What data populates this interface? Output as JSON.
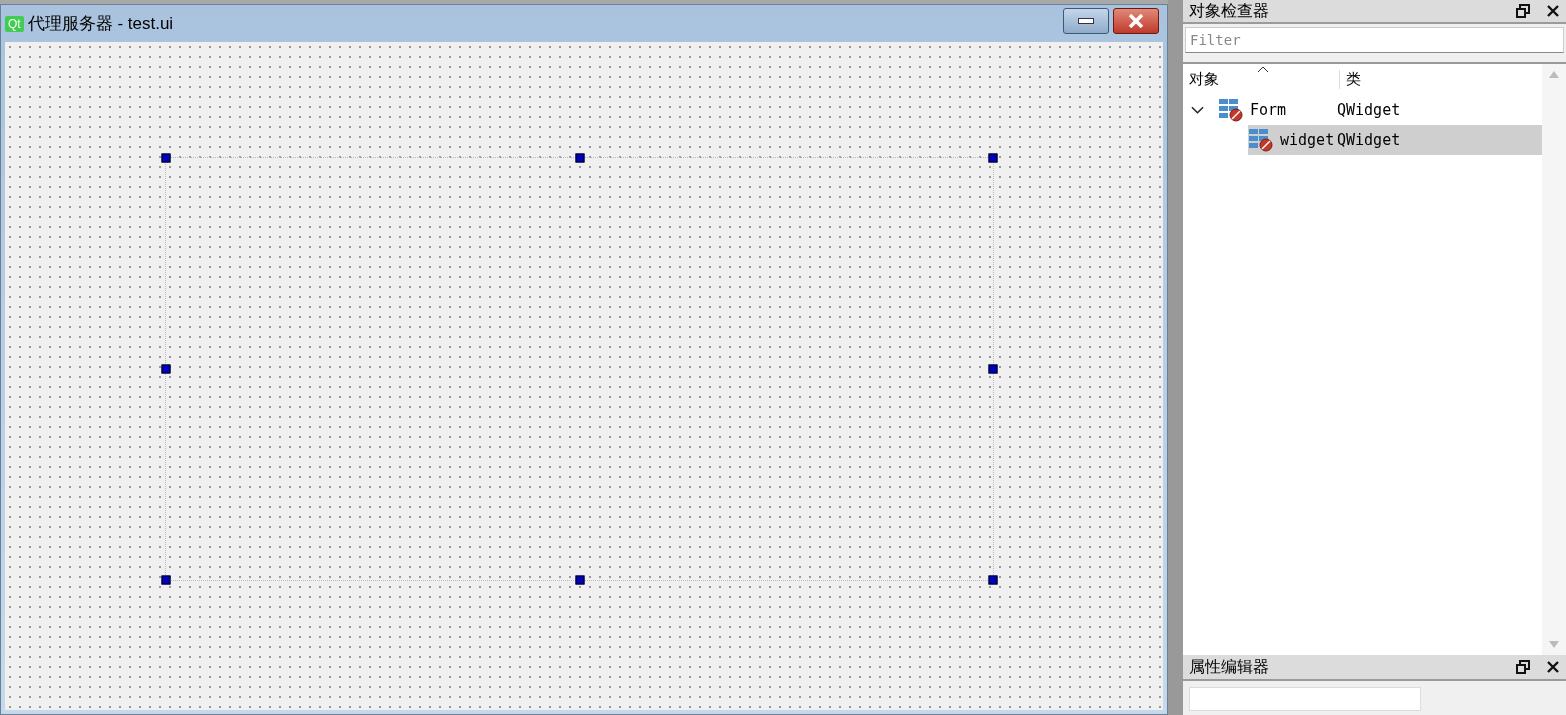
{
  "form_window": {
    "title": "代理服务器 - test.ui",
    "logo": "Qt",
    "selected_widget_visible": true
  },
  "object_inspector": {
    "title": "对象检查器",
    "filter": {
      "placeholder": "Filter"
    },
    "columns": [
      "对象",
      "类"
    ],
    "tree": [
      {
        "name": "Form",
        "class": "QWidget",
        "expanded": true,
        "selected": false,
        "children": [
          {
            "name": "widget",
            "class": "QWidget",
            "selected": true
          }
        ]
      }
    ]
  },
  "property_editor": {
    "title": "属性编辑器"
  }
}
